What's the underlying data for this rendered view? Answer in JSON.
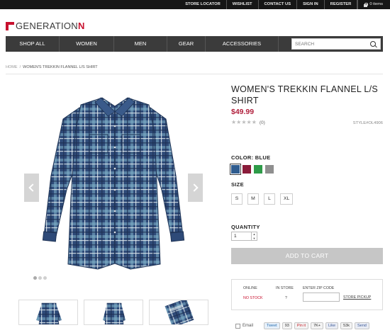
{
  "topbar": {
    "links": [
      "STORE LOCATOR",
      "WISHLIST",
      "CONTACT US",
      "SIGN IN",
      "REGISTER"
    ],
    "cart_label": "0 items"
  },
  "logo": {
    "prefix": "GENERATION",
    "suffix": "N"
  },
  "nav": {
    "items": [
      "SHOP ALL",
      "WOMEN",
      "MEN",
      "GEAR",
      "ACCESSORIES"
    ],
    "search_placeholder": "SEARCH"
  },
  "breadcrumb": {
    "home": "HOME",
    "sep": "/",
    "current": "WOMEN'S TREKKIN FLANNEL L/S SHIRT"
  },
  "product": {
    "title": "WOMEN'S TREKKIN FLANNEL L/S SHIRT",
    "price": "$49.99",
    "review_count": "(0)",
    "stars": "★★★★★",
    "style": "STYLE#OL4906",
    "color_label": "COLOR: BLUE",
    "colors": [
      {
        "name": "blue",
        "hex": "#2f5c8f"
      },
      {
        "name": "maroon",
        "hex": "#8a1c3a"
      },
      {
        "name": "green",
        "hex": "#2e9b48"
      },
      {
        "name": "gray",
        "hex": "#8f8f8f"
      }
    ],
    "size_label": "SIZE",
    "sizes": [
      "S",
      "M",
      "L",
      "XL"
    ],
    "quantity_label": "QUANTITY",
    "quantity_value": "1",
    "add_to_cart": "ADD TO CART"
  },
  "stock": {
    "online": "ONLINE",
    "in_store": "IN STORE",
    "zip_label": "ENTER ZIP CODE",
    "online_status": "NO STOCK",
    "store_status": "?",
    "pickup": "STORE PICKUP"
  },
  "social": {
    "email": "Email",
    "tweet": "Tweet",
    "tweet_count": "93",
    "pin": "Pin it",
    "pin_count": "7K+",
    "like": "Like",
    "like_count": "53k",
    "send": "Send"
  },
  "colors": {
    "accent": "#c8102e",
    "nav_bg": "#3b3b3b",
    "topbar_bg": "#161616",
    "price": "#b01e3b"
  }
}
